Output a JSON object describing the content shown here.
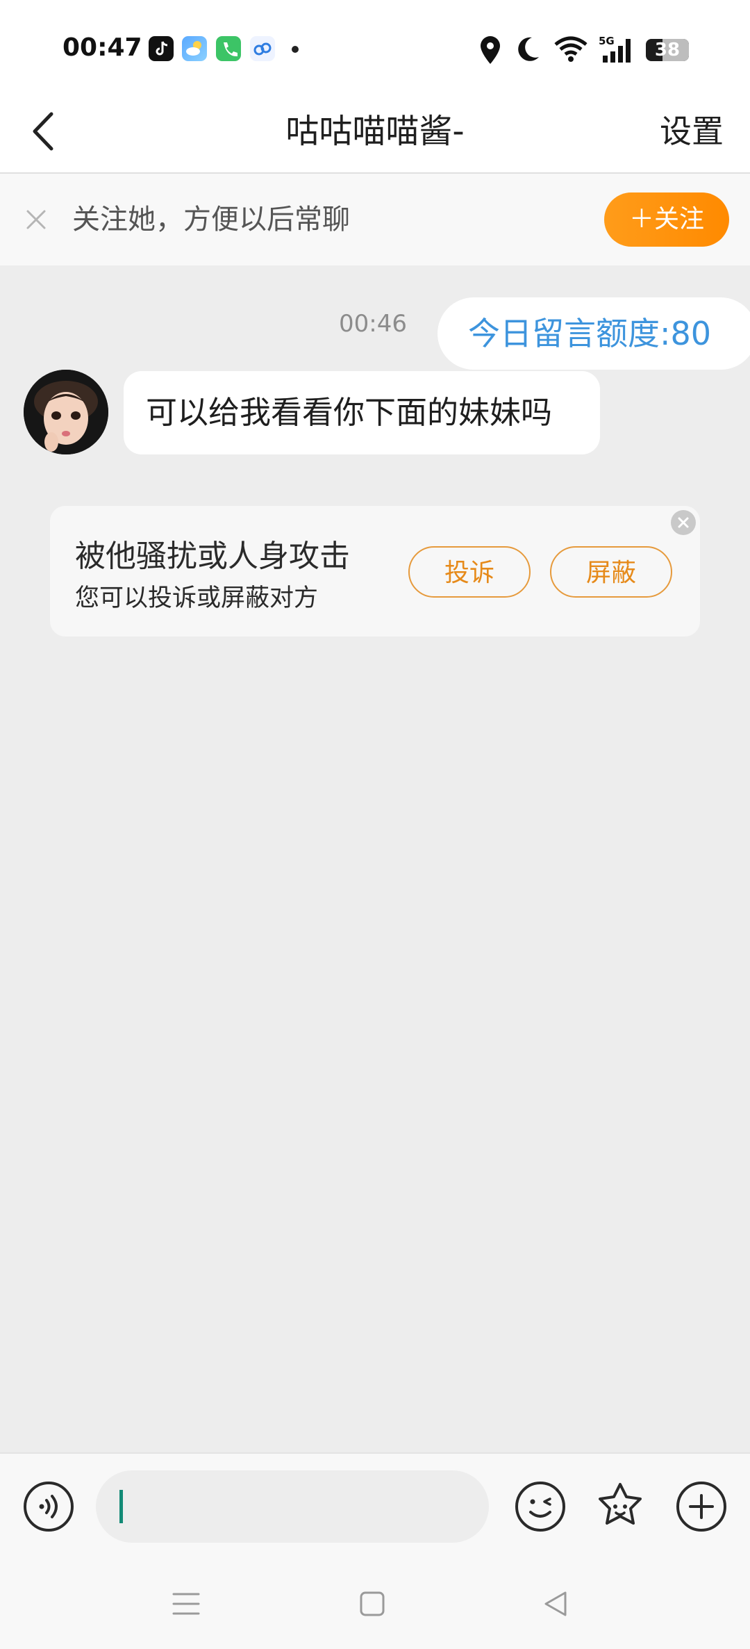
{
  "status_bar": {
    "time": "00:47",
    "battery": "38",
    "app_icons": [
      "tiktok-icon",
      "weather-icon",
      "phone-icon",
      "cloud-icon"
    ],
    "system_icons": [
      "location-icon",
      "moon-icon",
      "wifi-icon",
      "5g-signal-icon",
      "battery-icon"
    ],
    "network_label": "5G"
  },
  "nav": {
    "title": "咕咕喵喵酱-",
    "settings_label": "设置"
  },
  "follow_bar": {
    "text": "关注她，方便以后常聊",
    "button_label": "＋关注",
    "accent_color": "#ff9313"
  },
  "chat": {
    "timestamp": "00:46",
    "quota_text": "今日留言额度:80",
    "quota_color": "#3d94dd",
    "incoming_message": "可以给我看看你下面的妹妹吗"
  },
  "report_card": {
    "title": "被他骚扰或人身攻击",
    "subtitle": "您可以投诉或屏蔽对方",
    "complain_label": "投诉",
    "block_label": "屏蔽",
    "button_color": "#e68a1a"
  },
  "input_bar": {
    "placeholder": "",
    "icons": [
      "voice-icon",
      "emoji-icon",
      "sticker-icon",
      "plus-icon"
    ]
  },
  "system_nav": {
    "icons": [
      "menu-icon",
      "home-icon",
      "back-triangle-icon"
    ]
  }
}
